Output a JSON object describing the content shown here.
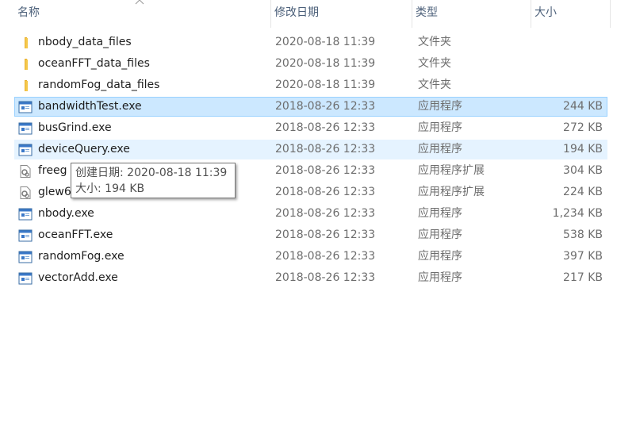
{
  "columns": {
    "name": "名称",
    "date": "修改日期",
    "type": "类型",
    "size": "大小"
  },
  "files": [
    {
      "icon": "folder-icon",
      "name": "nbody_data_files",
      "date": "2020-08-18 11:39",
      "type": "文件夹",
      "size": ""
    },
    {
      "icon": "folder-icon",
      "name": "oceanFFT_data_files",
      "date": "2020-08-18 11:39",
      "type": "文件夹",
      "size": ""
    },
    {
      "icon": "folder-icon",
      "name": "randomFog_data_files",
      "date": "2020-08-18 11:39",
      "type": "文件夹",
      "size": ""
    },
    {
      "icon": "exe-icon",
      "name": "bandwidthTest.exe",
      "date": "2018-08-26 12:33",
      "type": "应用程序",
      "size": "244 KB",
      "state": "selected"
    },
    {
      "icon": "exe-icon",
      "name": "busGrind.exe",
      "date": "2018-08-26 12:33",
      "type": "应用程序",
      "size": "272 KB"
    },
    {
      "icon": "exe-icon",
      "name": "deviceQuery.exe",
      "date": "2018-08-26 12:33",
      "type": "应用程序",
      "size": "194 KB",
      "state": "hover"
    },
    {
      "icon": "dll-icon",
      "name": "freeg",
      "date": "2018-08-26 12:33",
      "type": "应用程序扩展",
      "size": "304 KB"
    },
    {
      "icon": "dll-icon",
      "name": "glew6",
      "date": "2018-08-26 12:33",
      "type": "应用程序扩展",
      "size": "224 KB"
    },
    {
      "icon": "exe-icon",
      "name": "nbody.exe",
      "date": "2018-08-26 12:33",
      "type": "应用程序",
      "size": "1,234 KB"
    },
    {
      "icon": "exe-icon",
      "name": "oceanFFT.exe",
      "date": "2018-08-26 12:33",
      "type": "应用程序",
      "size": "538 KB"
    },
    {
      "icon": "exe-icon",
      "name": "randomFog.exe",
      "date": "2018-08-26 12:33",
      "type": "应用程序",
      "size": "397 KB"
    },
    {
      "icon": "exe-icon",
      "name": "vectorAdd.exe",
      "date": "2018-08-26 12:33",
      "type": "应用程序",
      "size": "217 KB"
    }
  ],
  "tooltip": {
    "created": "创建日期: 2020-08-18 11:39",
    "size": "大小: 194 KB"
  },
  "colors": {
    "selected_bg": "#cce8ff",
    "hover_bg": "#e5f3ff",
    "folder": "#f5c84c",
    "header_text": "#4c607a"
  }
}
